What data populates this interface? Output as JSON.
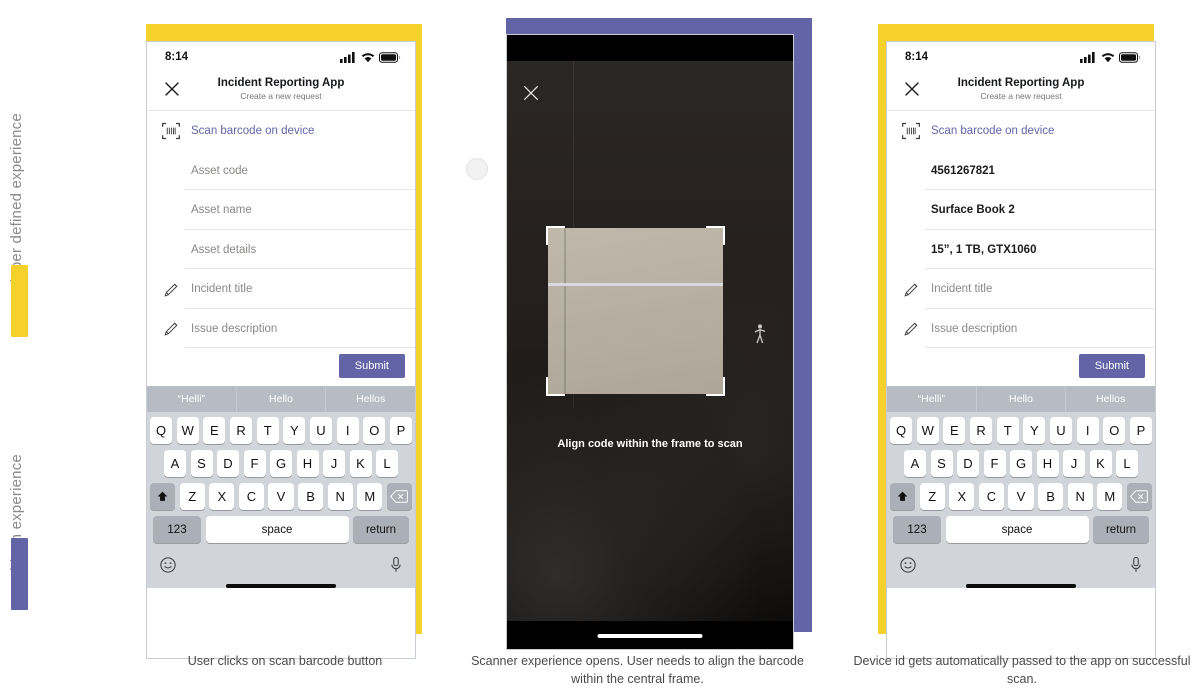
{
  "rail": {
    "items": [
      {
        "label": "Developer defined experience",
        "color": "#F7D12B"
      },
      {
        "label": "API driven experience",
        "color": "#6264A7"
      }
    ]
  },
  "colors": {
    "yellow": "#F7D12B",
    "purple": "#6264A7",
    "teams_purple": "#6264A7",
    "link": "#6264a7",
    "placeholder": "#8a8886"
  },
  "panels": [
    {
      "id": "panel-form-empty",
      "background": "#F7D12B",
      "caption": "User clicks on scan barcode button",
      "phone": {
        "status": {
          "time": "8:14",
          "cellular_icon": "signal-bars-icon",
          "wifi_icon": "wifi-icon",
          "battery_icon": "battery-icon"
        },
        "header": {
          "close_icon": "close-x-icon",
          "title": "Incident Reporting App",
          "subtitle": "Create a new request"
        },
        "rows": [
          {
            "icon": "barcode-scan-icon",
            "text": "Scan barcode on device",
            "style": "link"
          },
          {
            "icon": "",
            "text": "Asset code",
            "style": "placeholder"
          },
          {
            "icon": "",
            "text": "Asset name",
            "style": "placeholder"
          },
          {
            "icon": "",
            "text": "Asset details",
            "style": "placeholder"
          },
          {
            "icon": "pencil-icon",
            "text": "Incident title",
            "style": "placeholder"
          },
          {
            "icon": "pencil-icon",
            "text": "Issue description",
            "style": "placeholder"
          }
        ],
        "submit_label": "Submit",
        "keyboard": {
          "suggestions": [
            "“Helli”",
            "Hello",
            "Hellos"
          ],
          "row1": [
            "Q",
            "W",
            "E",
            "R",
            "T",
            "Y",
            "U",
            "I",
            "O",
            "P"
          ],
          "row2": [
            "A",
            "S",
            "D",
            "F",
            "G",
            "H",
            "J",
            "K",
            "L"
          ],
          "row3": [
            "Z",
            "X",
            "C",
            "V",
            "B",
            "N",
            "M"
          ],
          "shift_icon": "shift-up-arrow-icon",
          "backspace_icon": "backspace-icon",
          "num_label": "123",
          "space_label": "space",
          "return_label": "return",
          "emoji_icon": "emoji-smiley-icon",
          "mic_icon": "microphone-icon"
        }
      }
    },
    {
      "id": "panel-scanner",
      "background": "#6264A7",
      "caption": "Scanner experience opens. User needs to align the barcode within the central frame.",
      "scanner": {
        "close_icon": "close-x-icon",
        "hint": "Align code within the frame to scan",
        "frame_icon": "scan-frame-corners",
        "person_icon": "person-icon",
        "home_indicator": "home-indicator"
      }
    },
    {
      "id": "panel-form-filled",
      "background": "#F7D12B",
      "caption": "Device id gets automatically passed to the app on successful scan.",
      "phone": {
        "status": {
          "time": "8:14",
          "cellular_icon": "signal-bars-icon",
          "wifi_icon": "wifi-icon",
          "battery_icon": "battery-icon"
        },
        "header": {
          "close_icon": "close-x-icon",
          "title": "Incident Reporting App",
          "subtitle": "Create a new request"
        },
        "rows": [
          {
            "icon": "barcode-scan-icon",
            "text": "Scan barcode on device",
            "style": "link"
          },
          {
            "icon": "",
            "text": "4561267821",
            "style": "filled"
          },
          {
            "icon": "",
            "text": "Surface Book 2",
            "style": "filled"
          },
          {
            "icon": "",
            "text": "15”, 1 TB, GTX1060",
            "style": "filled"
          },
          {
            "icon": "pencil-icon",
            "text": "Incident title",
            "style": "placeholder"
          },
          {
            "icon": "pencil-icon",
            "text": "Issue description",
            "style": "placeholder"
          }
        ],
        "submit_label": "Submit",
        "keyboard": {
          "suggestions": [
            "“Helli”",
            "Hello",
            "Hellos"
          ],
          "row1": [
            "Q",
            "W",
            "E",
            "R",
            "T",
            "Y",
            "U",
            "I",
            "O",
            "P"
          ],
          "row2": [
            "A",
            "S",
            "D",
            "F",
            "G",
            "H",
            "J",
            "K",
            "L"
          ],
          "row3": [
            "Z",
            "X",
            "C",
            "V",
            "B",
            "N",
            "M"
          ],
          "shift_icon": "shift-up-arrow-icon",
          "backspace_icon": "backspace-icon",
          "num_label": "123",
          "space_label": "space",
          "return_label": "return",
          "emoji_icon": "emoji-smiley-icon",
          "mic_icon": "microphone-icon"
        }
      }
    }
  ]
}
